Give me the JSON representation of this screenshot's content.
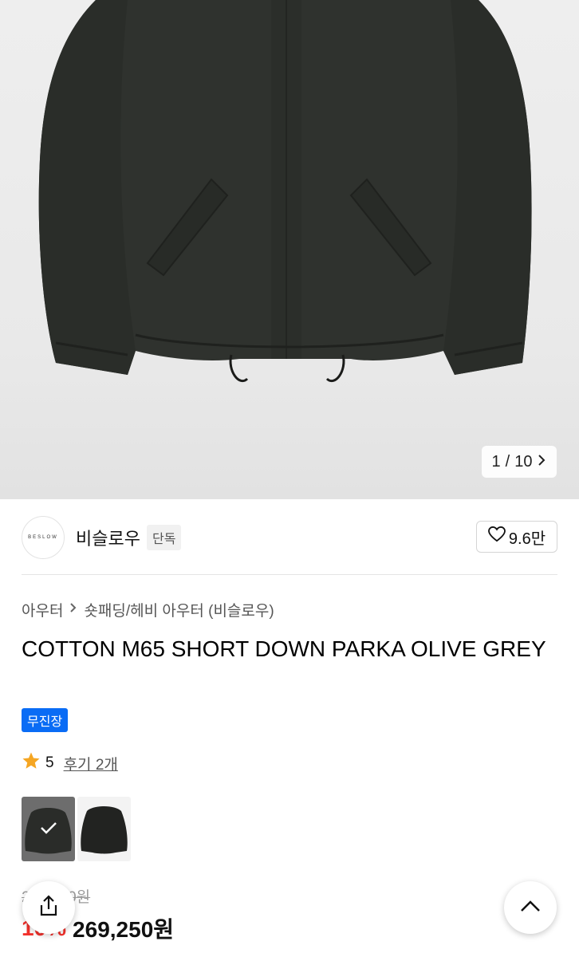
{
  "gallery": {
    "current": "1",
    "separator": "/",
    "total": "10"
  },
  "brand": {
    "logo_text": "BESLOW",
    "name": "비슬로우",
    "tag": "단독",
    "likes": "9.6만"
  },
  "breadcrumb": {
    "category": "아우터",
    "subcategory": "숏패딩/헤비 아우터 (비슬로우)"
  },
  "product": {
    "title": "COTTON M65 SHORT DOWN PARKA OLIVE GREY",
    "badge": "무진장",
    "rating": "5",
    "reviews": "후기 2개"
  },
  "price": {
    "original": "299,000원",
    "discount": "10%",
    "final": "269,250원"
  },
  "colors": {
    "jacket": "#2f322e",
    "badge": "#0a6cf5",
    "discount": "#f2312c",
    "star": "#f5a623"
  },
  "icons": [
    "chevron-right-icon",
    "heart-icon",
    "star-icon",
    "check-icon",
    "share-icon",
    "chevron-up-icon"
  ]
}
